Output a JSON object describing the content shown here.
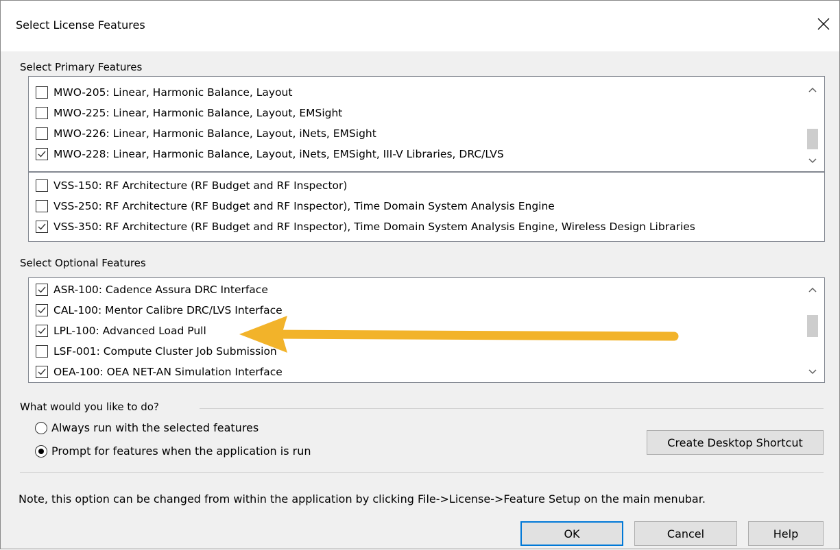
{
  "window": {
    "title": "Select License Features"
  },
  "primary": {
    "label": "Select Primary Features",
    "mwo_items": [
      {
        "label": "MWO-205: Linear, Harmonic Balance, Layout",
        "checked": false
      },
      {
        "label": "MWO-225: Linear, Harmonic Balance, Layout, EMSight",
        "checked": false
      },
      {
        "label": "MWO-226: Linear, Harmonic Balance, Layout, iNets, EMSight",
        "checked": false
      },
      {
        "label": "MWO-228: Linear, Harmonic Balance, Layout, iNets, EMSight, III-V Libraries, DRC/LVS",
        "checked": true
      }
    ],
    "vss_items": [
      {
        "label": "VSS-150: RF Architecture (RF Budget and RF Inspector)",
        "checked": false
      },
      {
        "label": "VSS-250: RF Architecture (RF Budget and RF Inspector), Time Domain System Analysis Engine",
        "checked": false
      },
      {
        "label": "VSS-350: RF Architecture (RF Budget and RF Inspector), Time Domain System Analysis Engine, Wireless Design Libraries",
        "checked": true
      }
    ]
  },
  "optional": {
    "label": "Select Optional Features",
    "items": [
      {
        "label": "ASR-100: Cadence Assura DRC Interface",
        "checked": true
      },
      {
        "label": "CAL-100: Mentor Calibre DRC/LVS Interface",
        "checked": true
      },
      {
        "label": "LPL-100: Advanced Load Pull",
        "checked": true
      },
      {
        "label": "LSF-001: Compute Cluster Job Submission",
        "checked": false
      },
      {
        "label": "OEA-100: OEA NET-AN Simulation Interface",
        "checked": true
      }
    ]
  },
  "action": {
    "label": "What would you like to do?",
    "options": [
      {
        "label": "Always run with the selected features",
        "selected": false
      },
      {
        "label": "Prompt for features when the application is run",
        "selected": true
      }
    ],
    "shortcut_button": "Create Desktop Shortcut"
  },
  "note": "Note, this option can be changed from within the application by clicking File->License->Feature Setup on the main menubar.",
  "buttons": {
    "ok": "OK",
    "cancel": "Cancel",
    "help": "Help"
  },
  "colors": {
    "accent": "#0078d7",
    "annotation_arrow": "#f2b32a"
  },
  "icons": {
    "close": "close-icon",
    "scroll_up": "chevron-up-icon",
    "scroll_down": "chevron-down-icon",
    "check": "check-icon"
  }
}
